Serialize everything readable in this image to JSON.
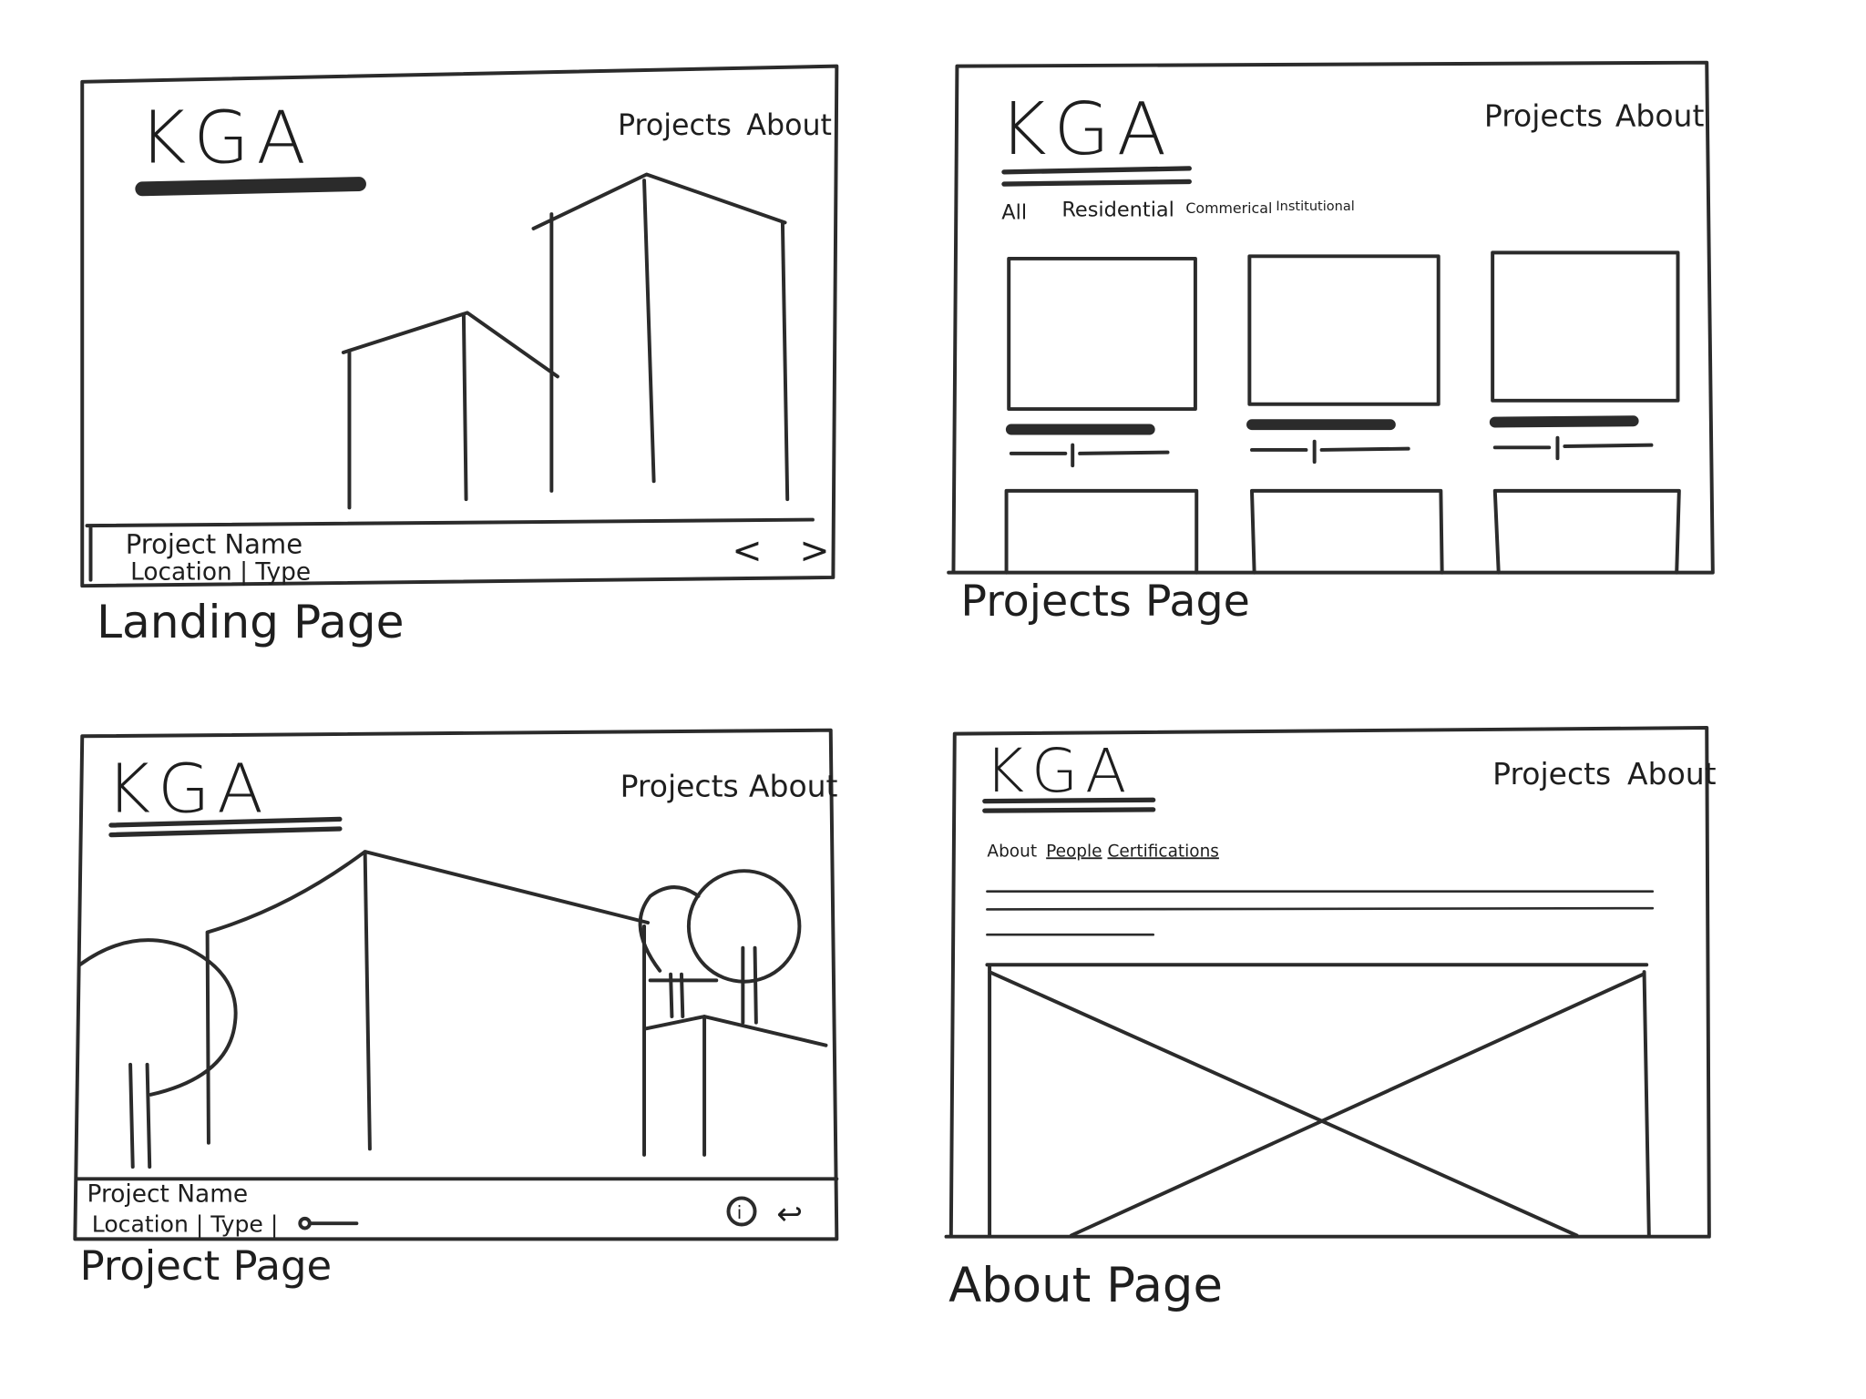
{
  "wireframes": {
    "landing": {
      "caption": "Landing Page",
      "logo": "KGA",
      "nav": [
        "Projects",
        "About"
      ],
      "footer_title": "Project Name",
      "footer_meta": "Location | Type",
      "prev_icon": "<",
      "next_icon": ">"
    },
    "projects": {
      "caption": "Projects Page",
      "logo": "KGA",
      "nav": [
        "Projects",
        "About"
      ],
      "filters": [
        "All",
        "Residential",
        "Commerical",
        "Institutional"
      ]
    },
    "project": {
      "caption": "Project Page",
      "logo": "KGA",
      "nav": [
        "Projects",
        "About"
      ],
      "footer_title": "Project Name",
      "footer_meta": "Location | Type |",
      "info_icon": "i",
      "share_icon": "↩"
    },
    "about": {
      "caption": "About Page",
      "logo": "KGA",
      "nav": [
        "Projects",
        "About"
      ],
      "subnav": [
        "About",
        "People",
        "Certifications"
      ]
    }
  }
}
